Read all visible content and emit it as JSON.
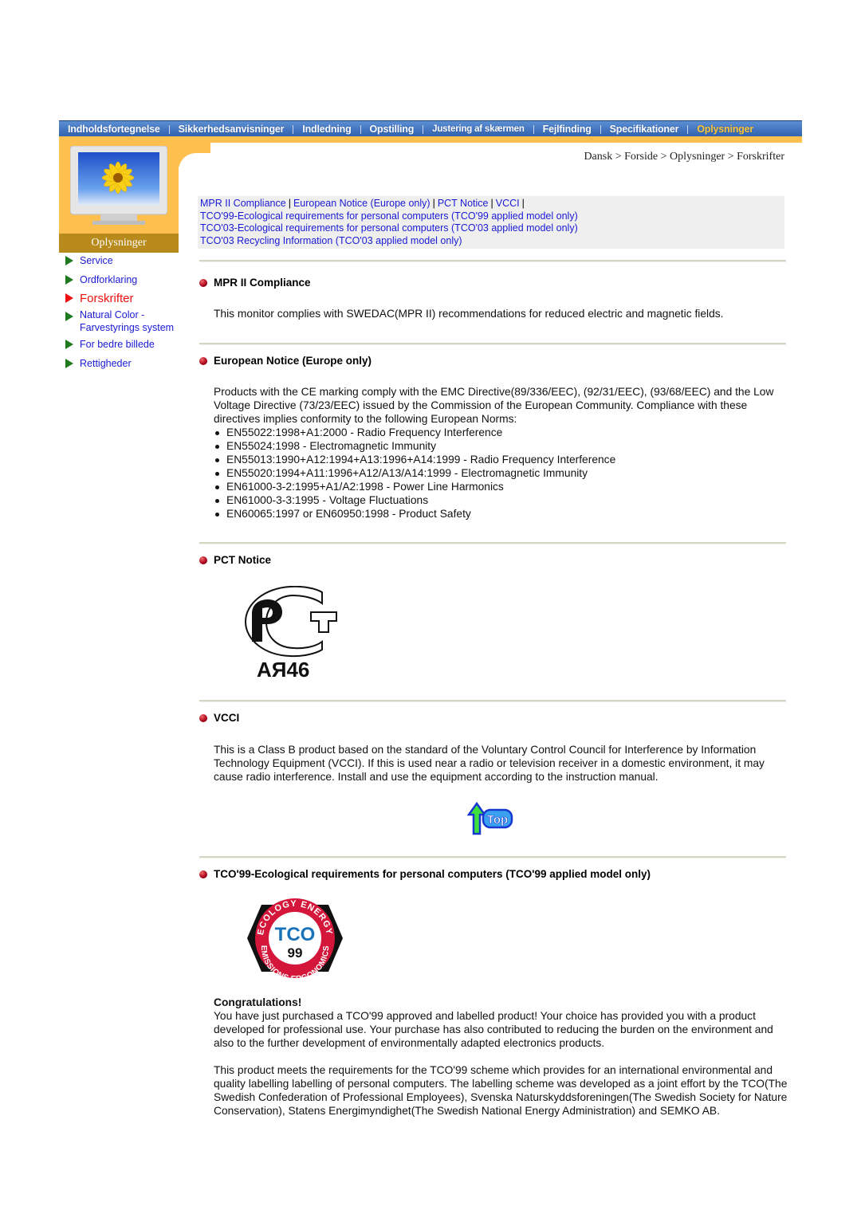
{
  "nav": {
    "items": [
      {
        "label": "Indholdsfortegnelse",
        "active": false
      },
      {
        "label": "Sikkerhedsanvisninger",
        "active": false
      },
      {
        "label": "Indledning",
        "active": false
      },
      {
        "label": "Opstilling",
        "active": false
      },
      {
        "label": "Justering af skærmen",
        "active": false
      },
      {
        "label": "Fejlfinding",
        "active": false
      },
      {
        "label": "Specifikationer",
        "active": false
      },
      {
        "label": "Oplysninger",
        "active": true
      }
    ],
    "active_color": "#ffc83a"
  },
  "sidebar": {
    "section_label": "Oplysninger",
    "items": [
      {
        "label": "Service",
        "active": false
      },
      {
        "label": "Ordforklaring",
        "active": false
      },
      {
        "label": "Forskrifter",
        "active": true
      },
      {
        "label": "Natural Color - Farvestyrings system",
        "active": false
      },
      {
        "label": "For bedre billede",
        "active": false
      },
      {
        "label": "Rettigheder",
        "active": false
      }
    ]
  },
  "breadcrumb": "Dansk > Forside > Oplysninger > Forskrifter",
  "quick_links": {
    "row1": [
      "MPR II Compliance",
      "European Notice (Europe only)",
      "PCT Notice",
      "VCCI"
    ],
    "separator": "|",
    "tco99": "TCO'99-Ecological requirements for personal computers (TCO'99 applied model only)",
    "tco03": "TCO'03-Ecological requirements for personal computers (TCO'03 applied model only)",
    "tco03_recycling": "TCO'03 Recycling Information (TCO'03 applied model only)"
  },
  "sections": {
    "mpr": {
      "title": "MPR II Compliance",
      "text": "This monitor complies with SWEDAC(MPR II) recommendations for reduced electric and magnetic fields."
    },
    "european": {
      "title": "European Notice (Europe only)",
      "text": "Products with the CE marking comply with the EMC Directive(89/336/EEC), (92/31/EEC), (93/68/EEC) and the Low Voltage Directive (73/23/EEC) issued by the Commission of the European Community. Compliance with these directives implies conformity to the following European Norms:",
      "norms": [
        "EN55022:1998+A1:2000 - Radio Frequency Interference",
        "EN55024:1998 - Electromagnetic Immunity",
        "EN55013:1990+A12:1994+A13:1996+A14:1999 - Radio Frequency Interference",
        "EN55020:1994+A11:1996+A12/A13/A14:1999 - Electromagnetic Immunity",
        "EN61000-3-2:1995+A1/A2:1998 - Power Line Harmonics",
        "EN61000-3-3:1995 - Voltage Fluctuations",
        "EN60065:1997 or EN60950:1998 - Product Safety"
      ]
    },
    "pct": {
      "title": "PCT Notice",
      "logo_code": "AЯ46"
    },
    "vcci": {
      "title": "VCCI",
      "text": "This is a Class B product based on the standard of the Voluntary Control Council for Interference by Information Technology Equipment (VCCI). If this is used near a radio or television receiver in a domestic environment, it may cause radio interference. Install and use the equipment according to the instruction manual.",
      "top_label": "Top"
    },
    "tco99": {
      "title": "TCO'99-Ecological requirements for personal computers (TCO'99 applied model only)",
      "logo": {
        "top_text": "ECOLOGY ENERGY",
        "bottom_text": "EMISSIONS ERGONOMICS",
        "brand": "TCO",
        "year": "99"
      },
      "congrats_title": "Congratulations!",
      "congrats_text": "You have just purchased a TCO'99 approved and labelled product! Your choice has provided you with a product developed for professional use. Your purchase has also contributed to reducing the burden on the environment and also to the further development of environmentally adapted electronics products.",
      "scheme_text": "This product meets the requirements for the TCO'99 scheme which provides for an international environmental and quality labelling labelling of personal computers. The labelling scheme was developed as a joint effort by the TCO(The Swedish Confederation of Professional Employees), Svenska Naturskyddsforeningen(The Swedish Society for Nature Conservation), Statens Energimyndighet(The Swedish National Energy Administration) and SEMKO AB."
    }
  }
}
